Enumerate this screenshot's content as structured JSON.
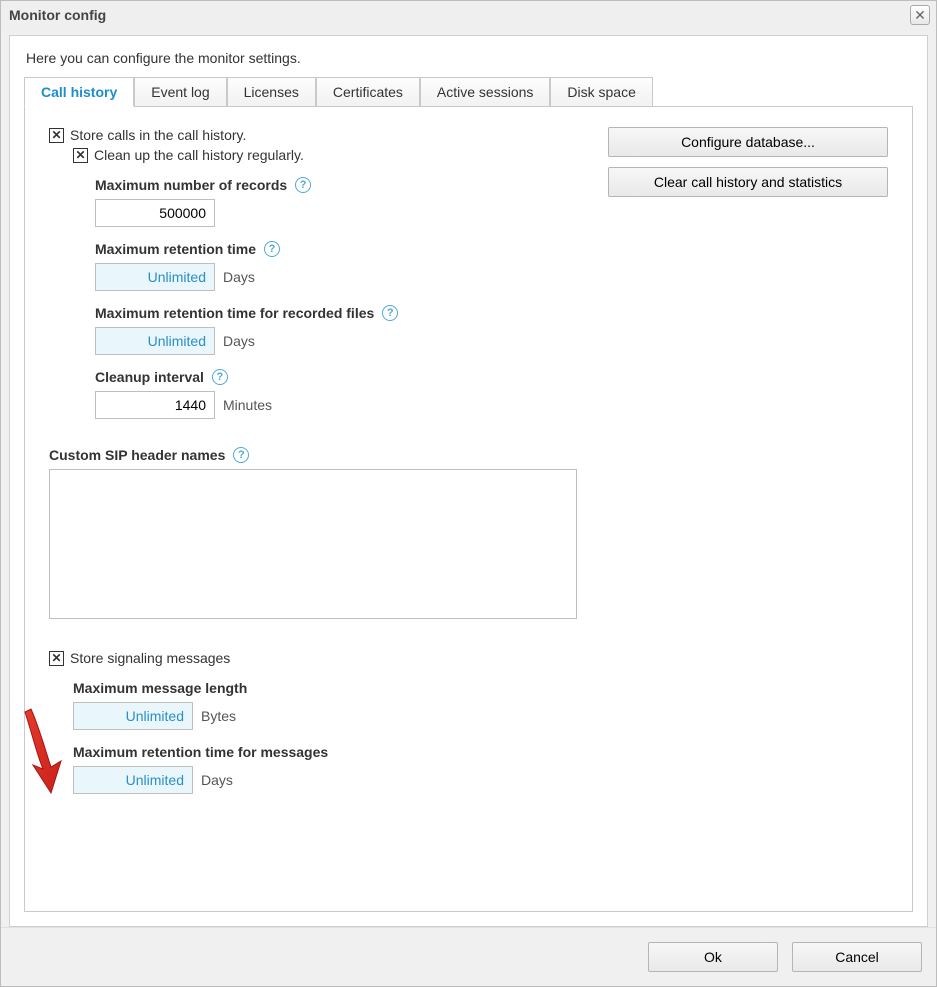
{
  "dialog": {
    "title": "Monitor config",
    "intro": "Here you can configure the monitor settings."
  },
  "tabs": [
    {
      "label": "Call history",
      "active": true
    },
    {
      "label": "Event log",
      "active": false
    },
    {
      "label": "Licenses",
      "active": false
    },
    {
      "label": "Certificates",
      "active": false
    },
    {
      "label": "Active sessions",
      "active": false
    },
    {
      "label": "Disk space",
      "active": false
    }
  ],
  "call_history": {
    "store_calls_label": "Store calls in the call history.",
    "cleanup_label": "Clean up the call history regularly.",
    "max_records_label": "Maximum number of records",
    "max_records_value": "500000",
    "max_retention_label": "Maximum retention time",
    "max_retention_value": "Unlimited",
    "max_retention_unit": "Days",
    "max_retention_files_label": "Maximum retention time for recorded files",
    "max_retention_files_value": "Unlimited",
    "max_retention_files_unit": "Days",
    "cleanup_interval_label": "Cleanup interval",
    "cleanup_interval_value": "1440",
    "cleanup_interval_unit": "Minutes",
    "sip_header_label": "Custom SIP header names",
    "sip_header_value": ""
  },
  "signaling": {
    "store_label": "Store signaling messages",
    "max_len_label": "Maximum message length",
    "max_len_value": "Unlimited",
    "max_len_unit": "Bytes",
    "max_ret_label": "Maximum retention time for messages",
    "max_ret_value": "Unlimited",
    "max_ret_unit": "Days"
  },
  "right_buttons": {
    "configure_db": "Configure database...",
    "clear_history": "Clear call history and statistics"
  },
  "footer": {
    "ok": "Ok",
    "cancel": "Cancel"
  }
}
